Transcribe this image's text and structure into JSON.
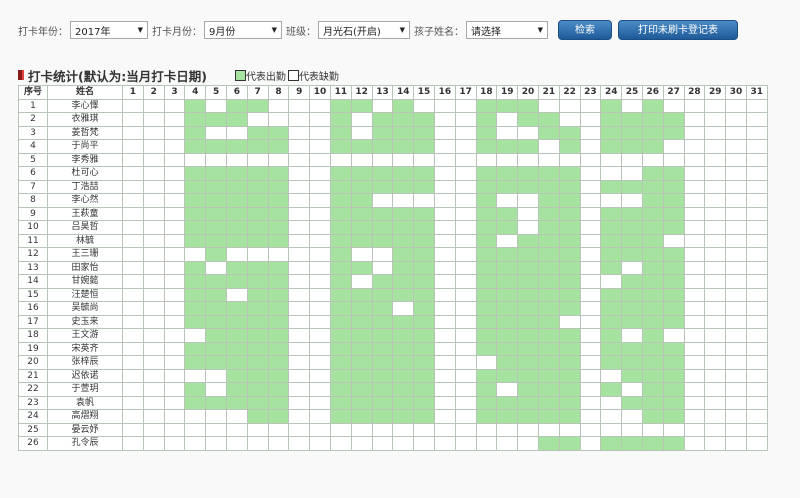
{
  "filters": {
    "year_label": "打卡年份：",
    "year_value": "2017年",
    "month_label": "打卡月份：",
    "month_value": "9月份",
    "class_label": "班级：",
    "class_value": "月光石(开启)",
    "child_label": "孩子姓名：",
    "child_value": "请选择",
    "search_button": "检索",
    "print_button": "打印未刷卡登记表"
  },
  "section": {
    "title": "打卡统计(默认为:当月打卡日期)",
    "legend_present": "代表出勤",
    "legend_absent": "代表缺勤"
  },
  "colors": {
    "present": "#a6e3a1",
    "absent": "#ffffff",
    "button": "#2a6aad",
    "title_mark": "#8b1a1a"
  },
  "table": {
    "col_index": "序号",
    "col_name": "姓名",
    "days": [
      "1",
      "2",
      "3",
      "4",
      "5",
      "6",
      "7",
      "8",
      "9",
      "10",
      "11",
      "12",
      "13",
      "14",
      "15",
      "16",
      "17",
      "18",
      "19",
      "20",
      "21",
      "22",
      "23",
      "24",
      "25",
      "26",
      "27",
      "28",
      "29",
      "30",
      "31"
    ],
    "rows": [
      {
        "no": "1",
        "name": "李心懌",
        "att": "0001011000110100011100010100000"
      },
      {
        "no": "2",
        "name": "衣雅琪",
        "att": "0001110000101110010110011110000"
      },
      {
        "no": "3",
        "name": "姜哲梵",
        "att": "0001001100101110010011011110000"
      },
      {
        "no": "4",
        "name": "于尚平",
        "att": "0001111100111110011101011100000"
      },
      {
        "no": "5",
        "name": "李秀雅",
        "att": "0000000000000000000000000000000"
      },
      {
        "no": "6",
        "name": "杜可心",
        "att": "0001111100111110011111000110000"
      },
      {
        "no": "7",
        "name": "丁浩喆",
        "att": "0001111100111110011111011110000"
      },
      {
        "no": "8",
        "name": "李心然",
        "att": "0001111100110000010011000110000"
      },
      {
        "no": "9",
        "name": "王萩童",
        "att": "0001111100111110011011011110000"
      },
      {
        "no": "10",
        "name": "吕昊哲",
        "att": "0001111100111110011011011110000"
      },
      {
        "no": "11",
        "name": "林毓",
        "att": "0001111100111110010111011100000"
      },
      {
        "no": "12",
        "name": "王三珊",
        "att": "0000100000100110011111011110000"
      },
      {
        "no": "13",
        "name": "田家怡",
        "att": "0001011100110110011111010110000"
      },
      {
        "no": "14",
        "name": "甘婉懿",
        "att": "0001111100101110011111001110000"
      },
      {
        "no": "15",
        "name": "汪楚恒",
        "att": "0001101100111110011111011110000"
      },
      {
        "no": "16",
        "name": "吴毓尚",
        "att": "0001111100111010011111011110000"
      },
      {
        "no": "17",
        "name": "史玉来",
        "att": "0001111100111110011110011110000"
      },
      {
        "no": "18",
        "name": "王文游",
        "att": "0000111100111110011111010100000"
      },
      {
        "no": "19",
        "name": "宋英齐",
        "att": "0001111100111110011111011110000"
      },
      {
        "no": "20",
        "name": "张梓辰",
        "att": "0001111100111110001111011110000"
      },
      {
        "no": "21",
        "name": "迟依诺",
        "att": "0000011100111110011111001110000"
      },
      {
        "no": "22",
        "name": "于萱玥",
        "att": "0001011100111110010111010110000"
      },
      {
        "no": "23",
        "name": "袁帆",
        "att": "0001111100111110011111001110000"
      },
      {
        "no": "24",
        "name": "高熠翔",
        "att": "0000001100111110011111000110000"
      },
      {
        "no": "25",
        "name": "晏云妤",
        "att": "0000000000000000000000000000000"
      },
      {
        "no": "26",
        "name": "孔令辰",
        "att": "0000000000000000000011011110000"
      }
    ]
  }
}
